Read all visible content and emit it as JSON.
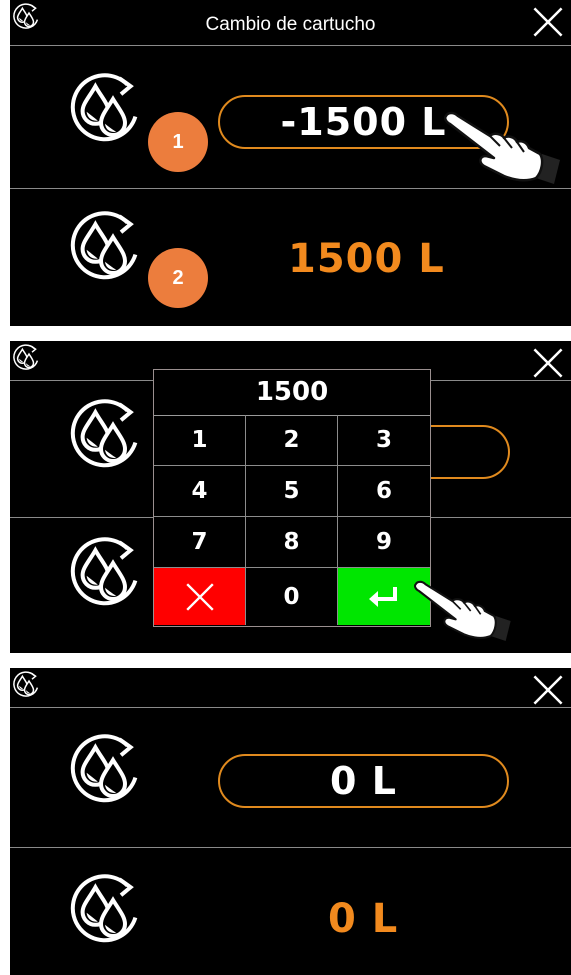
{
  "panel1": {
    "title": "Cambio de cartucho",
    "row1_value": "-1500 L",
    "row2_value": "1500 L",
    "step1": "1",
    "step2": "2"
  },
  "panel2": {
    "display": "1500",
    "keys": [
      "1",
      "2",
      "3",
      "4",
      "5",
      "6",
      "7",
      "8",
      "9",
      "0"
    ]
  },
  "panel3": {
    "row1_value": "0 L",
    "row2_value": "0 L"
  },
  "colors": {
    "accent_orange": "#e08a1e",
    "value_orange": "#f28a1e",
    "step_badge": "#ec7d3d",
    "cancel_red": "#ff0000",
    "enter_green": "#00e600"
  },
  "icons": {
    "cartridge": "cartridge-change-icon",
    "close": "close-icon",
    "hand": "pointing-hand-icon",
    "enter": "enter-icon"
  }
}
